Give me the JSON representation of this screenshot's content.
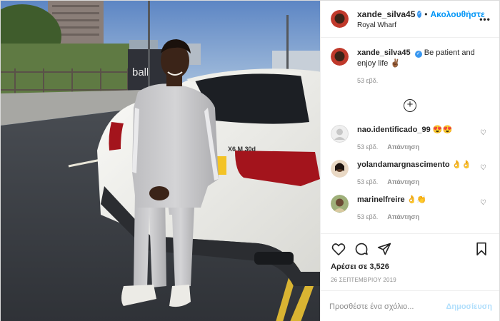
{
  "post": {
    "username": "xande_silva45",
    "follow_label": "Ακολουθήστε",
    "location": "Royal Wharf",
    "caption_text": "Be patient and enjoy life ✌🏾",
    "caption_time": "53 εβδ."
  },
  "comments": [
    {
      "username": "nao.identificado_99",
      "text": "😍😍",
      "time": "53 εβδ.",
      "reply": "Απάντηση"
    },
    {
      "username": "yolandamargnascimento",
      "text": "👌👌",
      "time": "53 εβδ.",
      "reply": "Απάντηση"
    },
    {
      "username": "marinelfreire",
      "text": "👌👏",
      "time": "53 εβδ.",
      "reply": "Απάντηση"
    }
  ],
  "actions": {
    "likes": "Αρέσει σε 3,526",
    "date": "26 ΣΕΠΤΕΜΒΡΙΟΥ 2019"
  },
  "composer": {
    "placeholder": "Προσθέστε ένα σχόλιο...",
    "publish_label": "Δημοσίευση"
  },
  "photo": {
    "plate_text": "Y",
    "car_badge": "X6 M 30d",
    "sign_text": "ball"
  },
  "colors": {
    "accent": "#0095f6",
    "verified": "#3897f0",
    "publish_disabled": "#b2dffc"
  }
}
